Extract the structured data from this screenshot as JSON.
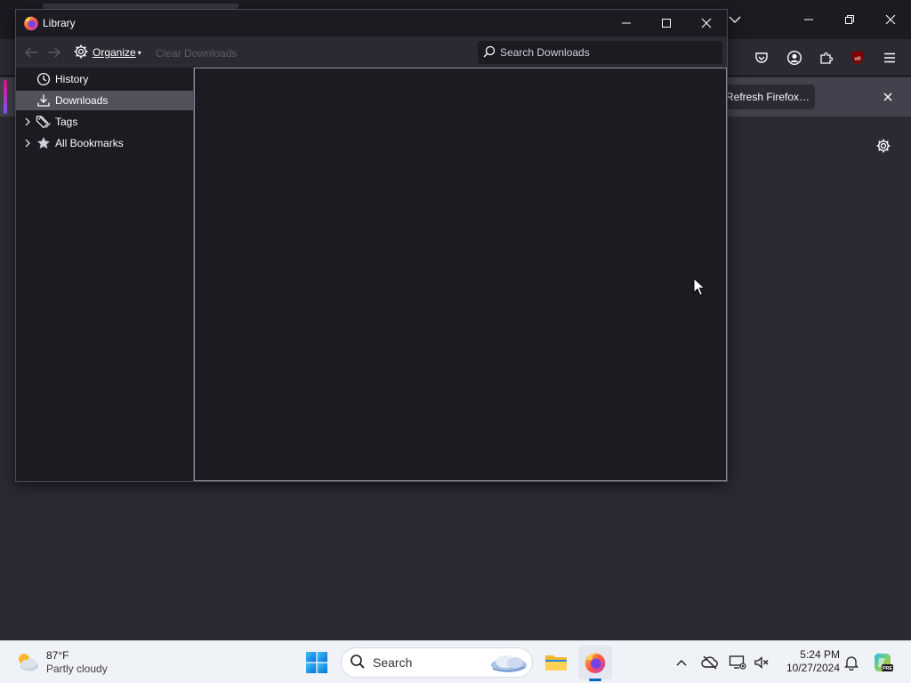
{
  "firefox": {
    "refresh_label": "Refresh Firefox…"
  },
  "library": {
    "title": "Library",
    "toolbar": {
      "organize_label": "Organize",
      "clear_label": "Clear Downloads",
      "search_placeholder": "Search Downloads"
    },
    "sidebar": {
      "items": [
        {
          "label": "History",
          "icon": "clock-icon",
          "selected": false,
          "expandable": false
        },
        {
          "label": "Downloads",
          "icon": "download-icon",
          "selected": true,
          "expandable": false
        },
        {
          "label": "Tags",
          "icon": "tag-icon",
          "selected": false,
          "expandable": true
        },
        {
          "label": "All Bookmarks",
          "icon": "star-icon",
          "selected": false,
          "expandable": true
        }
      ]
    }
  },
  "taskbar": {
    "weather": {
      "temp": "87°F",
      "condition": "Partly cloudy"
    },
    "search_label": "Search",
    "clock": {
      "time": "5:24 PM",
      "date": "10/27/2024"
    }
  },
  "colors": {
    "window_bg": "#1c1b22",
    "toolbar_bg": "#2b2a33",
    "selected_row": "#53525c",
    "taskbar_bg": "#eff3f8",
    "accent_blue": "#0067c0"
  }
}
